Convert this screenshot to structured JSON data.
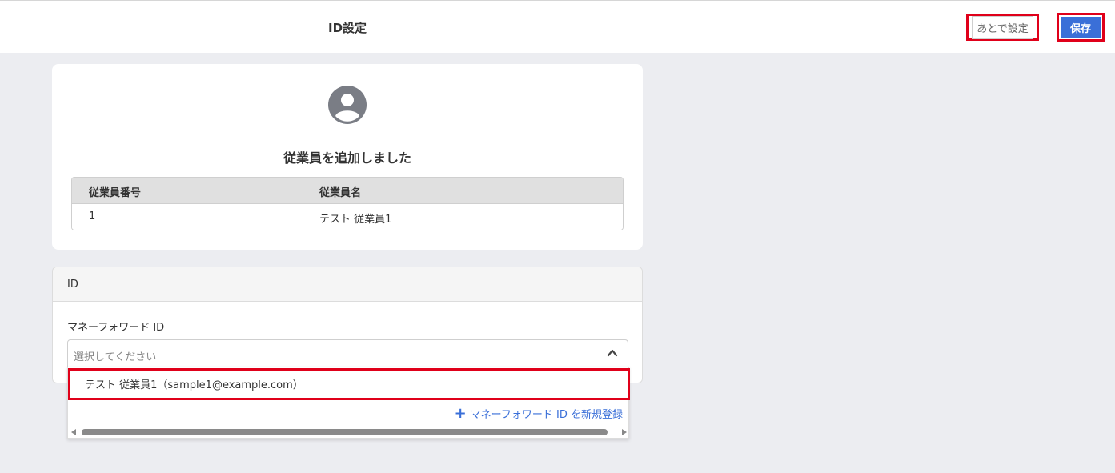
{
  "header": {
    "title": "ID設定",
    "later_label": "あとで設定",
    "save_label": "保存"
  },
  "summary_card": {
    "message": "従業員を追加しました",
    "table": {
      "headers": [
        "従業員番号",
        "従業員名"
      ],
      "rows": [
        [
          "1",
          "テスト 従業員1"
        ]
      ]
    }
  },
  "id_section": {
    "title": "ID",
    "field_label": "マネーフォワード ID",
    "select_placeholder": "選択してください",
    "options": [
      "テスト 従業員1（sample1@example.com）"
    ],
    "add_link_label": "マネーフォワード ID を新規登録"
  },
  "colors": {
    "primary": "#3a6fd8",
    "highlight": "#e0001a",
    "background": "#ecedf1"
  },
  "icons": {
    "avatar": "user-circle-icon",
    "select_toggle": "chevron-up-icon",
    "add": "plus-icon"
  }
}
